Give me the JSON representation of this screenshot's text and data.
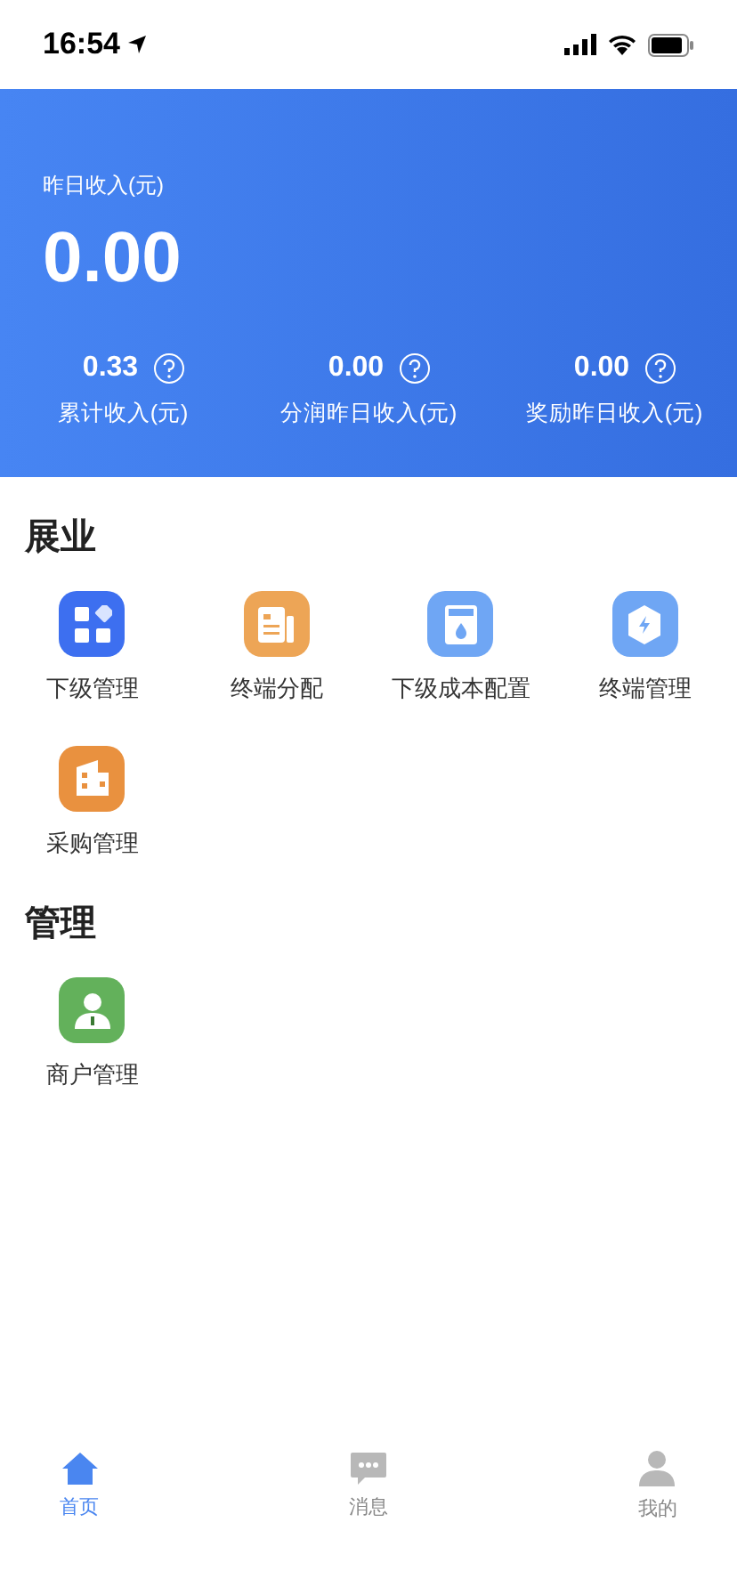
{
  "status_bar": {
    "time": "16:54"
  },
  "header": {
    "label": "昨日收入(元)",
    "amount": "0.00",
    "stats": [
      {
        "value": "0.33",
        "label": "累计收入(元)"
      },
      {
        "value": "0.00",
        "label": "分润昨日收入(元)"
      },
      {
        "value": "0.00",
        "label": "奖励昨日收入(元)"
      }
    ]
  },
  "sections": [
    {
      "title": "展业",
      "items": [
        {
          "label": "下级管理",
          "kind": "blocks",
          "color": "#3d6ff0"
        },
        {
          "label": "终端分配",
          "kind": "document",
          "color": "#eda556"
        },
        {
          "label": "下级成本配置",
          "kind": "meter",
          "color": "#6fa6f4"
        },
        {
          "label": "终端管理",
          "kind": "hexagon",
          "color": "#6fa6f4"
        },
        {
          "label": "采购管理",
          "kind": "building",
          "color": "#e9913f"
        }
      ]
    },
    {
      "title": "管理",
      "items": [
        {
          "label": "商户管理",
          "kind": "person",
          "color": "#63b15b"
        }
      ]
    }
  ],
  "tab_bar": [
    {
      "label": "首页",
      "kind": "home",
      "selected": true
    },
    {
      "label": "消息",
      "kind": "chat",
      "selected": false
    },
    {
      "label": "我的",
      "kind": "user",
      "selected": false
    }
  ]
}
